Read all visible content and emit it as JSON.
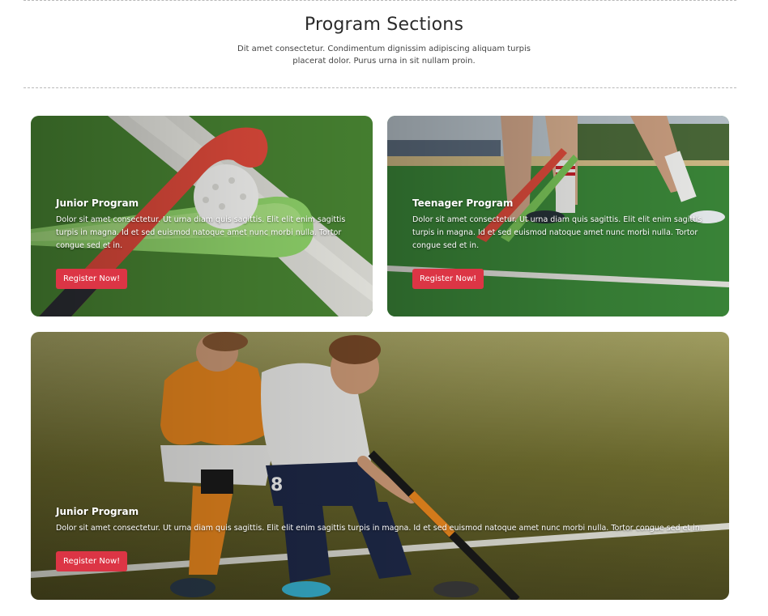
{
  "header": {
    "title": "Program Sections",
    "subtitle": "Dit amet consectetur. Condimentum dignissim adipiscing aliquam turpis placerat dolor. Purus urna in sit nullam proin."
  },
  "cards": [
    {
      "title": "Junior Program",
      "text": "Dolor sit amet consectetur. Ut urna diam quis sagittis. Elit elit enim sagittis turpis in magna. Id et sed euismod natoque amet nunc morbi nulla. Tortor congue sed et in.",
      "button": "Register Now!"
    },
    {
      "title": "Teenager Program",
      "text": "Dolor sit amet consectetur. Ut urna diam quis sagittis. Elit elit enim sagittis turpis in magna. Id et sed euismod natoque amet nunc morbi nulla. Tortor congue sed et in.",
      "button": "Register Now!"
    },
    {
      "title": "Junior Program",
      "text": "Dolor sit amet consectetur. Ut urna diam quis sagittis. Elit elit enim sagittis turpis in magna. Id et sed euismod natoque amet nunc morbi nulla. Tortor congue sed et in.",
      "button": "Register Now!"
    }
  ],
  "colors": {
    "button": "#dc3545",
    "turf": "#3f8a3c",
    "divider": "#b9b9b9"
  }
}
